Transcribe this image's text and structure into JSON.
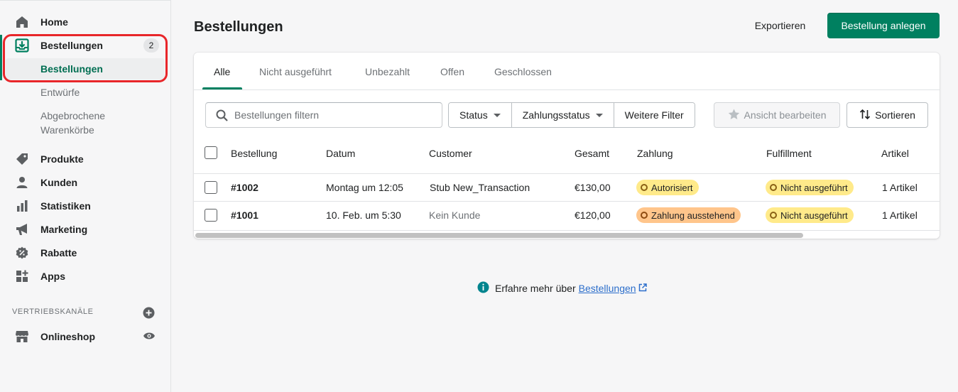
{
  "sidebar": {
    "items": [
      {
        "label": "Home",
        "icon": "home-icon"
      },
      {
        "label": "Bestellungen",
        "icon": "orders-icon",
        "badge": "2"
      },
      {
        "label": "Produkte",
        "icon": "tag-icon"
      },
      {
        "label": "Kunden",
        "icon": "person-icon"
      },
      {
        "label": "Statistiken",
        "icon": "analytics-icon"
      },
      {
        "label": "Marketing",
        "icon": "megaphone-icon"
      },
      {
        "label": "Rabatte",
        "icon": "discount-icon"
      },
      {
        "label": "Apps",
        "icon": "apps-icon"
      }
    ],
    "sub_items": [
      "Bestellungen",
      "Entwürfe",
      "Abgebrochene",
      "Warenkörbe"
    ],
    "section_label": "VERTRIEBSKANÄLE",
    "channel": {
      "label": "Onlineshop",
      "icon": "store-icon"
    }
  },
  "header": {
    "title": "Bestellungen",
    "export_label": "Exportieren",
    "create_label": "Bestellung anlegen"
  },
  "tabs": [
    "Alle",
    "Nicht ausgeführt",
    "Unbezahlt",
    "Offen",
    "Geschlossen"
  ],
  "filters": {
    "search_placeholder": "Bestellungen filtern",
    "status": "Status",
    "payment_status": "Zahlungsstatus",
    "more": "Weitere Filter",
    "edit_view": "Ansicht bearbeiten",
    "sort": "Sortieren"
  },
  "table": {
    "columns": [
      "Bestellung",
      "Datum",
      "Customer",
      "Gesamt",
      "Zahlung",
      "Fulfillment",
      "Artikel"
    ],
    "rows": [
      {
        "order": "#1002",
        "date": "Montag um 12:05",
        "customer": "Stub New_Transaction",
        "total": "€130,00",
        "payment": "Autorisiert",
        "fulfillment": "Nicht ausgeführt",
        "items": "1 Artikel"
      },
      {
        "order": "#1001",
        "date": "10. Feb. um 5:30",
        "customer": "Kein Kunde",
        "total": "€120,00",
        "payment": "Zahlung ausstehend",
        "fulfillment": "Nicht ausgeführt",
        "items": "1 Artikel"
      }
    ]
  },
  "footer": {
    "text": "Erfahre mehr über",
    "link": "Bestellungen"
  },
  "colors": {
    "accent": "#008060",
    "highlight": "#e8262a",
    "pill_yellow": "#ffea8a",
    "pill_orange": "#ffc58b",
    "link": "#2c6ecb"
  }
}
